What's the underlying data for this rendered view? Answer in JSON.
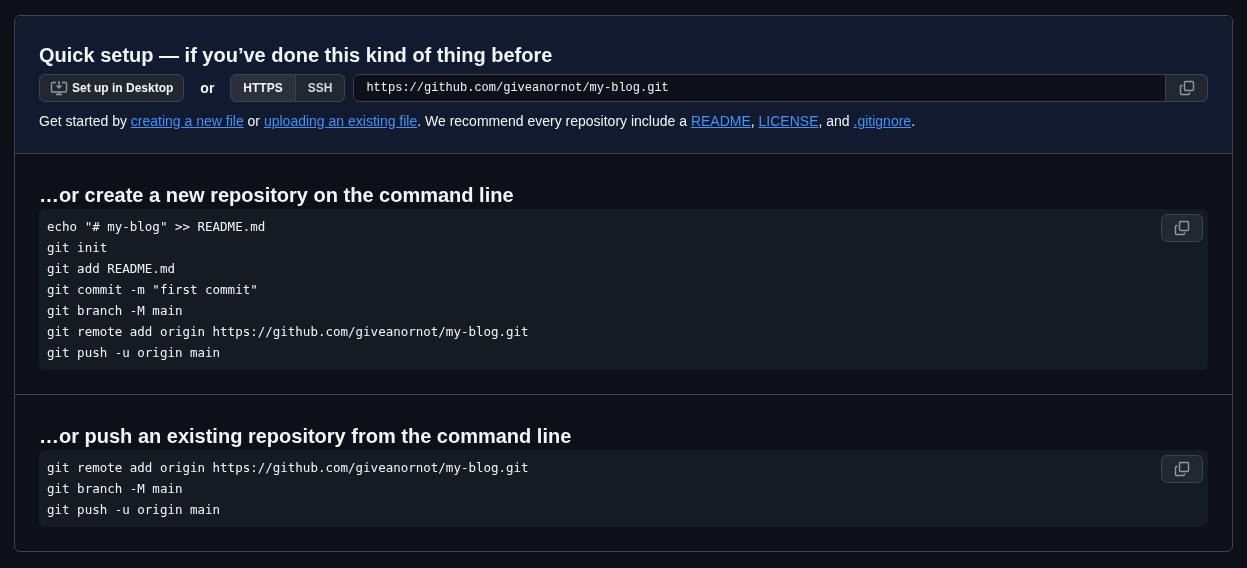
{
  "quick_setup": {
    "title": "Quick setup — if you’ve done this kind of thing before",
    "desktop_button": "Set up in Desktop",
    "or": "or",
    "protocols": [
      {
        "label": "HTTPS",
        "selected": true
      },
      {
        "label": "SSH",
        "selected": false
      }
    ],
    "clone_url": "https://github.com/giveanornot/my-blog.git",
    "intro": [
      {
        "kind": "text",
        "text": "Get started by"
      },
      {
        "kind": "link",
        "text": "creating a new file"
      },
      {
        "kind": "text",
        "text": "or"
      },
      {
        "kind": "link",
        "text": "uploading an existing file"
      },
      {
        "kind": "text",
        "text": ". We recommend every repository include a"
      },
      {
        "kind": "link",
        "text": "README"
      },
      {
        "kind": "text",
        "text": ","
      },
      {
        "kind": "link",
        "text": "LICENSE"
      },
      {
        "kind": "text",
        "text": ", and"
      },
      {
        "kind": "link",
        "text": ".gitignore"
      },
      {
        "kind": "text",
        "text": "."
      }
    ]
  },
  "sections": [
    {
      "title": "…or create a new repository on the command line",
      "lines": [
        "echo \"# my-blog\" >> README.md",
        "git init",
        "git add README.md",
        "git commit -m \"first commit\"",
        "git branch -M main",
        "git remote add origin https://github.com/giveanornot/my-blog.git",
        "git push -u origin main"
      ]
    },
    {
      "title": "…or push an existing repository from the command line",
      "lines": [
        "git remote add origin https://github.com/giveanornot/my-blog.git",
        "git branch -M main",
        "git push -u origin main"
      ]
    }
  ]
}
